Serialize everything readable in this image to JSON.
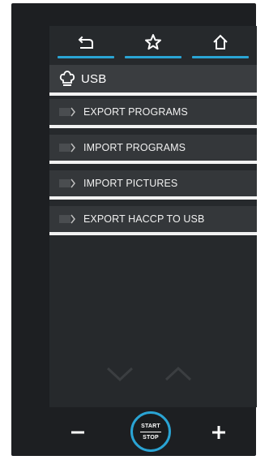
{
  "nav": {
    "back_icon": "back-icon",
    "favorite_icon": "star-icon",
    "home_icon": "home-icon",
    "accent": "#2aa4d4"
  },
  "header": {
    "icon": "chef-hat-icon",
    "title": "USB"
  },
  "menu": {
    "items": [
      {
        "label": "EXPORT PROGRAMS"
      },
      {
        "label": "IMPORT PROGRAMS"
      },
      {
        "label": "IMPORT PICTURES"
      },
      {
        "label": "EXPORT HACCP TO USB"
      }
    ]
  },
  "scroll": {
    "down_icon": "chevron-down-icon",
    "up_icon": "chevron-up-icon"
  },
  "controls": {
    "minus_icon": "minus-icon",
    "plus_icon": "plus-icon",
    "start_label": "START",
    "stop_label": "STOP"
  }
}
